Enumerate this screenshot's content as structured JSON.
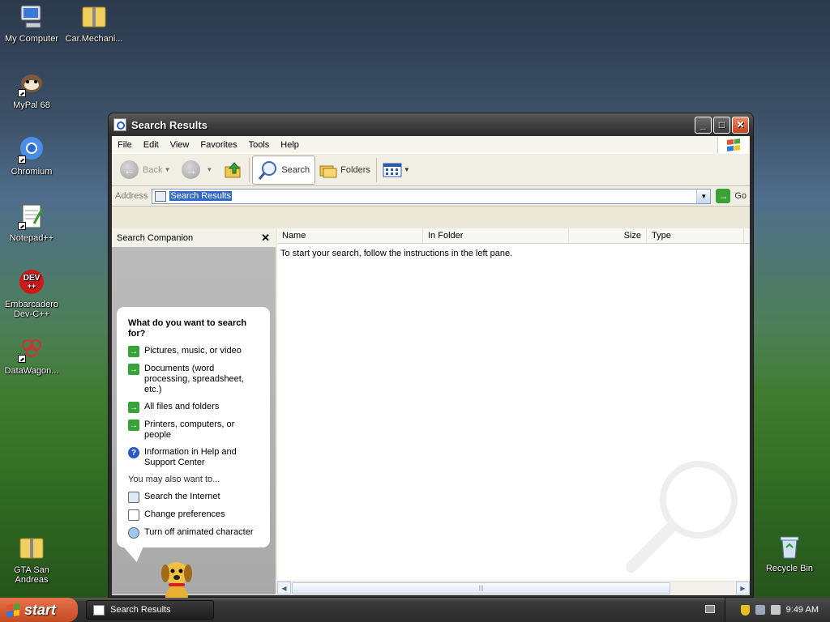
{
  "desktop": {
    "icons": [
      {
        "label": "My Computer",
        "icon": "computer-icon"
      },
      {
        "label": "Car.Mechani...",
        "icon": "zip-folder-icon"
      },
      {
        "label": "MyPal 68",
        "icon": "mypal-icon"
      },
      {
        "label": "Chromium",
        "icon": "chromium-icon"
      },
      {
        "label": "Notepad++",
        "icon": "notepad-icon"
      },
      {
        "label": "Embarcadero Dev-C++",
        "icon": "devcpp-icon"
      },
      {
        "label": "DataWagon...",
        "icon": "datawagon-icon"
      },
      {
        "label": "GTA San Andreas",
        "icon": "zip-folder-icon"
      },
      {
        "label": "Recycle Bin",
        "icon": "recycle-bin-icon"
      }
    ]
  },
  "window": {
    "title": "Search Results",
    "menu": [
      "File",
      "Edit",
      "View",
      "Favorites",
      "Tools",
      "Help"
    ],
    "toolbar": {
      "back": "Back",
      "search": "Search",
      "folders": "Folders"
    },
    "address": {
      "label": "Address",
      "value": "Search Results",
      "go": "Go"
    },
    "search_companion": {
      "header": "Search Companion",
      "question": "What do you want to search for?",
      "options": [
        "Pictures, music, or video",
        "Documents (word processing, spreadsheet, etc.)",
        "All files and folders",
        "Printers, computers, or people",
        "Information in Help and Support Center"
      ],
      "also_label": "You may also want to...",
      "also": [
        "Search the Internet",
        "Change preferences",
        "Turn off animated character"
      ]
    },
    "columns": [
      "Name",
      "In Folder",
      "Size",
      "Type"
    ],
    "empty_message": "To start your search, follow the instructions in the left pane."
  },
  "taskbar": {
    "start": "start",
    "task": "Search Results",
    "clock": "9:49 AM"
  },
  "colors": {
    "start": "#d9582c",
    "go": "#3aa235",
    "selection": "#316ac5"
  }
}
